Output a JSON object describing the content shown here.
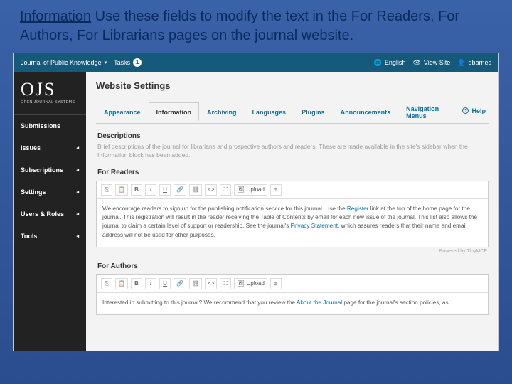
{
  "caption": {
    "title": "Information",
    "rest": " Use these fields to modify the text in the For Readers, For Authors, For Librarians pages on the journal website."
  },
  "topbar": {
    "journal": "Journal of Public Knowledge",
    "tasks_label": "Tasks",
    "tasks_count": "1",
    "language": "English",
    "view_site": "View Site",
    "user": "dbarnes"
  },
  "logo": {
    "big": "OJS",
    "sub": "OPEN JOURNAL SYSTEMS"
  },
  "sidebar": {
    "items": [
      {
        "label": "Submissions"
      },
      {
        "label": "Issues"
      },
      {
        "label": "Subscriptions"
      },
      {
        "label": "Settings"
      },
      {
        "label": "Users & Roles"
      },
      {
        "label": "Tools"
      }
    ]
  },
  "page": {
    "title": "Website Settings",
    "help": "Help"
  },
  "tabs": [
    {
      "label": "Appearance"
    },
    {
      "label": "Information"
    },
    {
      "label": "Archiving"
    },
    {
      "label": "Languages"
    },
    {
      "label": "Plugins"
    },
    {
      "label": "Announcements"
    },
    {
      "label": "Navigation Menus"
    }
  ],
  "descriptions": {
    "heading": "Descriptions",
    "text": "Brief descriptions of the journal for librarians and prospective authors and readers. These are made available in the site's sidebar when the Information block has been added."
  },
  "editors": {
    "upload": "Upload",
    "powered": "Powered by TinyMCE"
  },
  "for_readers": {
    "heading": "For Readers",
    "body_a": "We encourage readers to sign up for the publishing notification service for this journal. Use the ",
    "link1": "Register",
    "body_b": " link at the top of the home page for the journal. This registration will result in the reader receiving the Table of Contents by email for each new issue of the journal. This list also allows the journal to claim a certain level of support or readership. See the journal's ",
    "link2": "Privacy Statement",
    "body_c": ", which assures readers that their name and email address will not be used for other purposes."
  },
  "for_authors": {
    "heading": "For Authors",
    "body_a": "Interested in submitting to this journal? We recommend that you review the ",
    "link1": "About the Journal",
    "body_b": " page for the journal's section policies, as"
  }
}
